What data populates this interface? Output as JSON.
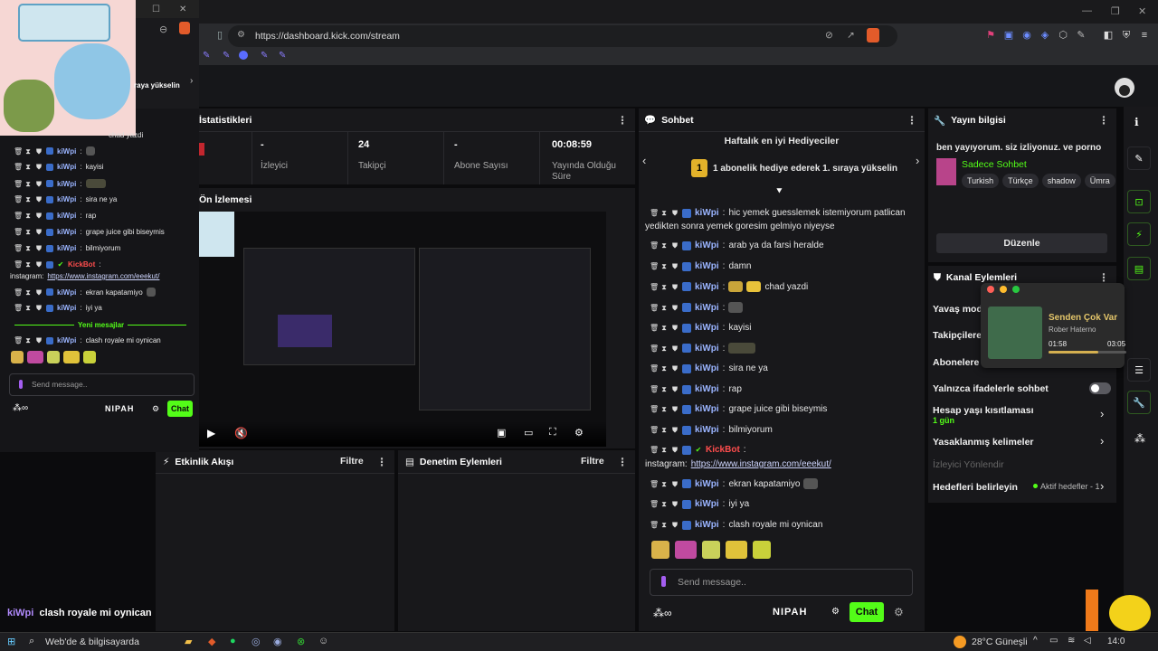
{
  "browser": {
    "url": "https://dashboard.kick.com/stream"
  },
  "stats": {
    "title": "İstatistikleri",
    "items": [
      {
        "value": "-",
        "label": "İzleyici"
      },
      {
        "value": "24",
        "label": "Takipçi"
      },
      {
        "value": "-",
        "label": "Abone Sayısı"
      },
      {
        "value": "00:08:59",
        "label": "Yayında Olduğu Süre"
      }
    ]
  },
  "preview": {
    "title": "Ön İzlemesi"
  },
  "activity": {
    "title": "Etkinlik Akışı",
    "filter": "Filtre"
  },
  "moderation": {
    "title": "Denetim Eylemleri",
    "filter": "Filtre"
  },
  "chat": {
    "title": "Sohbet",
    "gifters_title": "Haftalık en iyi Hediyeciler",
    "gifters_rank": "1",
    "gifters_text": "1 abonelik hediye ederek 1. sıraya yükselin",
    "messages": [
      {
        "user": "kiWpi",
        "text": "hic yemek guesslemek istemiyorum patlican",
        "cont": "yedikten sonra yemek goresim gelmiyo niyeyse"
      },
      {
        "user": "kiWpi",
        "text": "arab ya da farsi heralde"
      },
      {
        "user": "kiWpi",
        "text": "damn"
      },
      {
        "user": "kiWpi",
        "text": "chad yazdi"
      },
      {
        "user": "kiWpi",
        "text": ""
      },
      {
        "user": "kiWpi",
        "text": "kayisi"
      },
      {
        "user": "kiWpi",
        "text": ""
      },
      {
        "user": "kiWpi",
        "text": "sira ne ya"
      },
      {
        "user": "kiWpi",
        "text": "rap"
      },
      {
        "user": "kiWpi",
        "text": "grape juice gibi biseymis"
      },
      {
        "user": "kiWpi",
        "text": "bilmiyorum"
      },
      {
        "user": "KickBot",
        "text": ":",
        "cont_label": "instagram:",
        "cont_link": "https://www.instagram.com/eeekut/"
      },
      {
        "user": "kiWpi",
        "text": "ekran kapatamiyo"
      },
      {
        "user": "kiWpi",
        "text": "iyi ya"
      },
      {
        "user": "kiWpi",
        "text": "clash royale mi oynican"
      }
    ],
    "input_placeholder": "Send message..",
    "nipah": "NIPAH",
    "send_label": "Chat"
  },
  "stream_info": {
    "title": "Yayın bilgisi",
    "stream_title": "ben yayıyorum. siz izliyonuz. ve porno",
    "category": "Sadece Sohbet",
    "tags": [
      "Turkish",
      "Türkçe",
      "shadow",
      "Ümra"
    ],
    "edit_label": "Düzenle"
  },
  "channel_actions": {
    "title": "Kanal Eylemleri",
    "slow_mode": "Yavaş mod",
    "followers": "Takipçilere",
    "subscribers": "Abonelere ö",
    "emote_only": "Yalnızca ifadelerle sohbet",
    "account_age": "Hesap yaşı kısıtlaması",
    "account_age_value": "1 gün",
    "banned_words": "Yasaklanmış kelimeler",
    "viewer_redirect": "İzleyici Yönlendir",
    "goals": "Hedefleri belirleyin",
    "goals_status": "Aktif hedefler - 1"
  },
  "music": {
    "title": "Senden Çok Var",
    "artist": "Rober Haterno",
    "elapsed": "01:58",
    "total": "03:05",
    "progress": 0.64
  },
  "left_window": {
    "partial_text": "raya yükselin",
    "partial_text2": "chad yazdi",
    "messages": [
      {
        "user": "kiWpi",
        "text": ""
      },
      {
        "user": "kiWpi",
        "text": "kayisi"
      },
      {
        "user": "kiWpi",
        "text": ""
      },
      {
        "user": "kiWpi",
        "text": "sira ne ya"
      },
      {
        "user": "kiWpi",
        "text": "rap"
      },
      {
        "user": "kiWpi",
        "text": "grape juice gibi biseymis"
      },
      {
        "user": "kiWpi",
        "text": "bilmiyorum"
      },
      {
        "user": "KickBot",
        "text": ":"
      },
      {
        "user": "kiWpi",
        "text": "ekran kapatamiyo"
      },
      {
        "user": "kiWpi",
        "text": "iyi ya"
      }
    ],
    "kickbot_cont_label": "instagram:",
    "kickbot_cont_link": "https://www.instagram.com/eeekut/",
    "new_messages": "Yeni mesajlar",
    "last_msg_user": "kiWpi",
    "last_msg_text": "clash royale mi oynican",
    "input_placeholder": "Send message..",
    "nipah": "NIPAH",
    "send_label": "Chat"
  },
  "overlay": {
    "user": "kiWpi",
    "text": "clash royale mi oynican"
  },
  "taskbar": {
    "search": "Web'de & bilgisayarda",
    "weather": "28°C",
    "weather_desc": "Güneşli",
    "clock": "14:0"
  }
}
